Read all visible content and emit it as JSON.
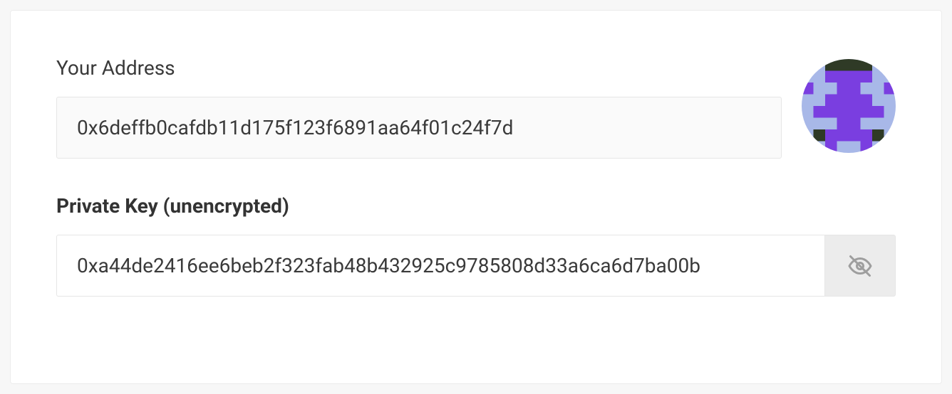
{
  "address": {
    "label": "Your Address",
    "value": "0x6deffb0cafdb11d175f123f6891aa64f01c24f7d"
  },
  "private_key": {
    "label": "Private Key (unencrypted)",
    "value": "0xa44de2416ee6beb2f323fab48b432925c9785808d33a6ca6d7ba00b"
  },
  "identicon": {
    "colors": {
      "bg": "#a8b8e8",
      "dark": "#2f3a26",
      "purple": "#7a3ee0"
    }
  }
}
